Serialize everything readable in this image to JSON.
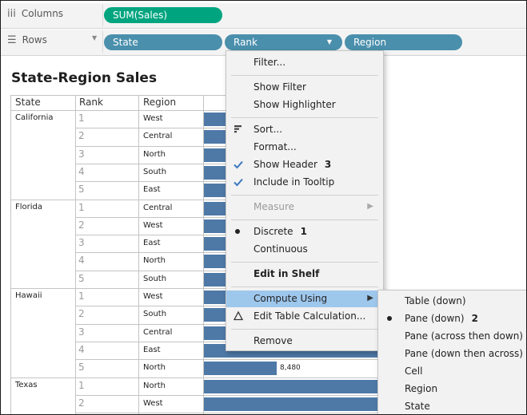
{
  "shelves": {
    "columns_label": "Columns",
    "rows_label": "Rows",
    "columns_pills": [
      "SUM(Sales)"
    ],
    "rows_pills": [
      "State",
      "Rank",
      "Region"
    ]
  },
  "sheet": {
    "title": "State-Region Sales",
    "headers": {
      "state": "State",
      "rank": "Rank",
      "region": "Region"
    },
    "groups": [
      {
        "state": "California",
        "rows": [
          {
            "rank": "1",
            "region": "West"
          },
          {
            "rank": "2",
            "region": "Central"
          },
          {
            "rank": "3",
            "region": "North"
          },
          {
            "rank": "4",
            "region": "South"
          },
          {
            "rank": "5",
            "region": "East"
          }
        ]
      },
      {
        "state": "Florida",
        "rows": [
          {
            "rank": "1",
            "region": "Central"
          },
          {
            "rank": "2",
            "region": "West"
          },
          {
            "rank": "3",
            "region": "East"
          },
          {
            "rank": "4",
            "region": "North"
          },
          {
            "rank": "5",
            "region": "South"
          }
        ]
      },
      {
        "state": "Hawaii",
        "rows": [
          {
            "rank": "1",
            "region": "West"
          },
          {
            "rank": "2",
            "region": "South"
          },
          {
            "rank": "3",
            "region": "Central"
          },
          {
            "rank": "4",
            "region": "East"
          },
          {
            "rank": "5",
            "region": "North",
            "label": "8,480"
          }
        ]
      },
      {
        "state": "Texas",
        "rows": [
          {
            "rank": "1",
            "region": "North"
          },
          {
            "rank": "2",
            "region": "West"
          }
        ]
      }
    ]
  },
  "context_menu": {
    "items": [
      {
        "label": "Filter...",
        "type": "item"
      },
      {
        "type": "sep"
      },
      {
        "label": "Show Filter",
        "type": "item"
      },
      {
        "label": "Show Highlighter",
        "type": "item"
      },
      {
        "type": "sep"
      },
      {
        "label": "Sort...",
        "type": "item",
        "icon": "sort-icon"
      },
      {
        "label": "Format...",
        "type": "item"
      },
      {
        "label": "Show Header",
        "type": "item",
        "icon": "check-icon",
        "annotation": "3"
      },
      {
        "label": "Include in Tooltip",
        "type": "item",
        "icon": "check-icon"
      },
      {
        "type": "sep"
      },
      {
        "label": "Measure",
        "type": "item",
        "disabled": true,
        "submenu": true
      },
      {
        "type": "sep"
      },
      {
        "label": "Discrete",
        "type": "item",
        "icon": "bullet-icon",
        "annotation": "1"
      },
      {
        "label": "Continuous",
        "type": "item"
      },
      {
        "type": "sep"
      },
      {
        "label": "Edit in Shelf",
        "type": "item",
        "bold": true
      },
      {
        "type": "sep"
      },
      {
        "label": "Compute Using",
        "type": "item",
        "highlighted": true,
        "submenu": true
      },
      {
        "label": "Edit Table Calculation...",
        "type": "item",
        "icon": "delta-icon"
      },
      {
        "type": "sep"
      },
      {
        "label": "Remove",
        "type": "item"
      }
    ]
  },
  "compute_submenu": {
    "items": [
      {
        "label": "Table (down)"
      },
      {
        "label": "Pane (down)",
        "selected": true,
        "annotation": "2"
      },
      {
        "label": "Pane (across then down)"
      },
      {
        "label": "Pane (down then across)"
      },
      {
        "label": "Cell"
      },
      {
        "label": "Region"
      },
      {
        "label": "State"
      }
    ]
  },
  "colors": {
    "measure_pill": "#00a57f",
    "dimension_pill": "#4a8fac",
    "bar": "#4e79a7",
    "menu_highlight": "#9ec7ec"
  }
}
